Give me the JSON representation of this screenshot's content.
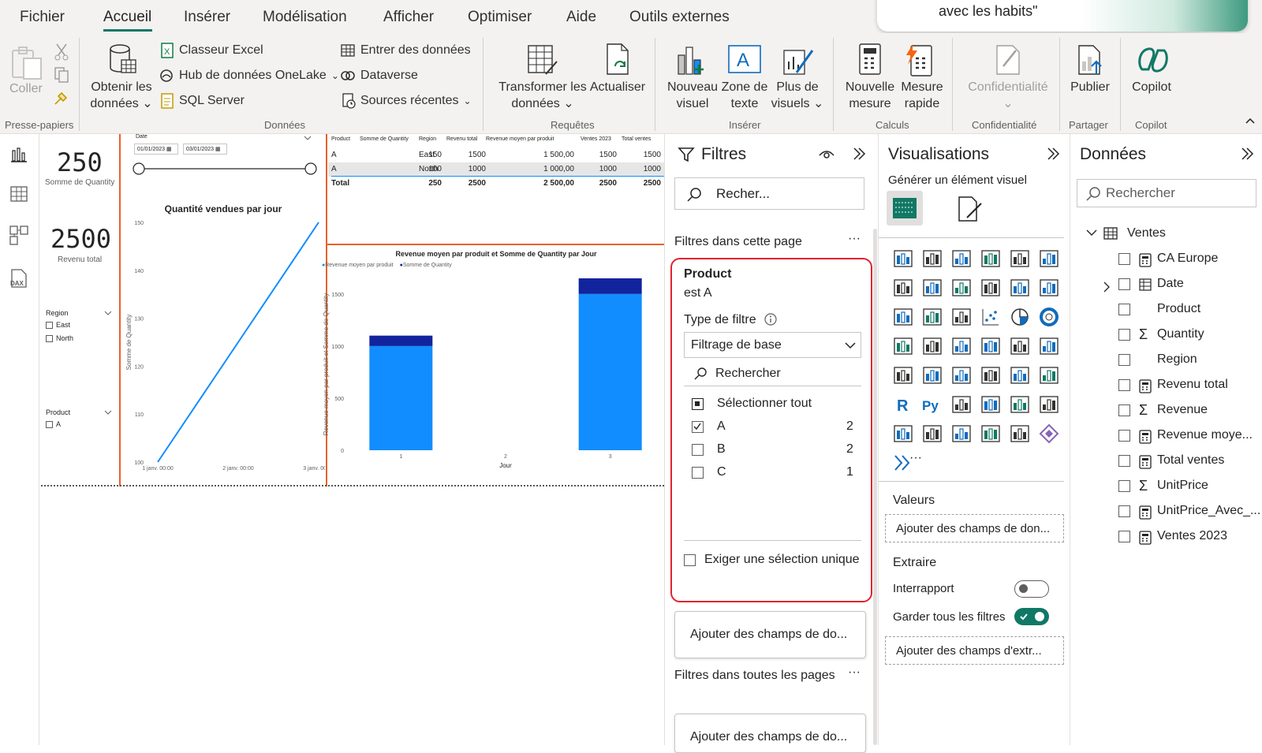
{
  "menu": {
    "items": [
      "Fichier",
      "Accueil",
      "Insérer",
      "Modélisation",
      "Afficher",
      "Optimiser",
      "Aide",
      "Outils externes"
    ],
    "active": "Accueil"
  },
  "toast": {
    "text": "avec les habits\""
  },
  "ribbon": {
    "coller": "Coller",
    "presse_papiers": "Presse-papiers",
    "obtenir_line1": "Obtenir les",
    "obtenir_line2": "données",
    "classeur_excel": "Classeur Excel",
    "hub_onelake": "Hub de données OneLake",
    "sql_server": "SQL Server",
    "entrer_donnees": "Entrer des données",
    "dataverse": "Dataverse",
    "sources_recentes": "Sources récentes",
    "donnees_group": "Données",
    "transformer_line1": "Transformer les",
    "transformer_line2": "données",
    "actualiser": "Actualiser",
    "requetes_group": "Requêtes",
    "nouveau_visuel_1": "Nouveau",
    "nouveau_visuel_2": "visuel",
    "zone_texte_1": "Zone de",
    "zone_texte_2": "texte",
    "plus_visuels_1": "Plus de",
    "plus_visuels_2": "visuels",
    "inserer_group": "Insérer",
    "nouvelle_mesure_1": "Nouvelle",
    "nouvelle_mesure_2": "mesure",
    "mesure_rapide_1": "Mesure",
    "mesure_rapide_2": "rapide",
    "calculs_group": "Calculs",
    "confidentialite": "Confidentialité",
    "confidentialite_group": "Confidentialité",
    "publier": "Publier",
    "partager_group": "Partager",
    "copilot": "Copilot",
    "copilot_group": "Copilot"
  },
  "report": {
    "card1": {
      "value": "250",
      "label": "Somme de Quantity"
    },
    "card2": {
      "value": "2500",
      "label": "Revenu total"
    },
    "region_slicer": {
      "title": "Region",
      "items": [
        "East",
        "North"
      ]
    },
    "product_slicer": {
      "title": "Product",
      "items": [
        "A"
      ]
    },
    "date_slicer": {
      "title": "Date",
      "from": "01/01/2023",
      "to": "03/01/2023"
    },
    "table": {
      "headers": [
        "Product",
        "Somme de Quantity",
        "Region",
        "Revenu total",
        "Revenue moyen par produit",
        "Ventes 2023",
        "Total ventes"
      ],
      "rows": [
        [
          "A",
          "150",
          "East",
          "1500",
          "1 500,00",
          "1500",
          "1500"
        ],
        [
          "A",
          "100",
          "North",
          "1000",
          "1 000,00",
          "1000",
          "1000"
        ]
      ],
      "total": [
        "Total",
        "250",
        "",
        "2500",
        "2 500,00",
        "2500",
        "2500"
      ]
    }
  },
  "chart_data": [
    {
      "type": "line",
      "title": "Quantité vendues par jour",
      "ylabel": "Somme de Quantity",
      "xlabel": "",
      "x": [
        "1 janv. 00:00",
        "2 janv. 00:00",
        "3 janv. 00:00"
      ],
      "series": [
        {
          "values": [
            100,
            125,
            150
          ]
        }
      ],
      "yticks": [
        100,
        110,
        120,
        130,
        140,
        150
      ],
      "ylim": [
        100,
        150
      ],
      "color": "#118dff"
    },
    {
      "type": "bar",
      "title": "Revenue moyen par produit et Somme de Quantity par Jour",
      "xlabel": "Jour",
      "ylabel": "Revenue moyen par produit et Somme de Quantity",
      "categories": [
        "1",
        "2",
        "3"
      ],
      "series": [
        {
          "name": "Revenue moyen par produit",
          "values": [
            1000,
            0,
            1500
          ],
          "color": "#118dff"
        },
        {
          "name": "Somme de Quantity",
          "values": [
            100,
            0,
            150
          ],
          "color": "#12239e"
        }
      ],
      "yticks": [
        0,
        500,
        1000,
        1500
      ],
      "ylim": [
        0,
        1650
      ],
      "stacked": true
    }
  ],
  "filters": {
    "title": "Filtres",
    "search_placeholder": "Recher...",
    "page_section": "Filtres dans cette page",
    "card": {
      "field": "Product",
      "condition": "est A",
      "type_label": "Type de filtre",
      "type_value": "Filtrage de base",
      "search": "Rechercher",
      "select_all": "Sélectionner tout",
      "options": [
        {
          "label": "A",
          "count": "2",
          "checked": true
        },
        {
          "label": "B",
          "count": "2",
          "checked": false
        },
        {
          "label": "C",
          "count": "1",
          "checked": false
        }
      ],
      "single_select": "Exiger une sélection unique"
    },
    "add_page_fields": "Ajouter des champs de do...",
    "all_pages_section": "Filtres dans toutes les pages",
    "add_all_fields": "Ajouter des champs de do..."
  },
  "viz": {
    "title": "Visualisations",
    "generate": "Générer un élément visuel",
    "valeurs": "Valeurs",
    "add_values": "Ajouter des champs de don...",
    "extraire": "Extraire",
    "interrapport": "Interrapport",
    "garder_filtres": "Garder tous les filtres",
    "add_extract": "Ajouter des champs d'extr...",
    "ellipsis": "···"
  },
  "data_pane": {
    "title": "Données",
    "search_placeholder": "Rechercher",
    "table": "Ventes",
    "fields": [
      {
        "name": "CA Europe",
        "icon": "calculator-icon"
      },
      {
        "name": "Date",
        "icon": "table-icon",
        "expand": true
      },
      {
        "name": "Product",
        "icon": ""
      },
      {
        "name": "Quantity",
        "icon": "sigma-icon"
      },
      {
        "name": "Region",
        "icon": ""
      },
      {
        "name": "Revenu total",
        "icon": "calculator-icon"
      },
      {
        "name": "Revenue",
        "icon": "sigma-icon"
      },
      {
        "name": "Revenue moye...",
        "icon": "calculator-icon"
      },
      {
        "name": "Total ventes",
        "icon": "calculator-icon"
      },
      {
        "name": "UnitPrice",
        "icon": "sigma-icon"
      },
      {
        "name": "UnitPrice_Avec_...",
        "icon": "calculator-icon"
      },
      {
        "name": "Ventes 2023",
        "icon": "calculator-icon"
      }
    ]
  }
}
